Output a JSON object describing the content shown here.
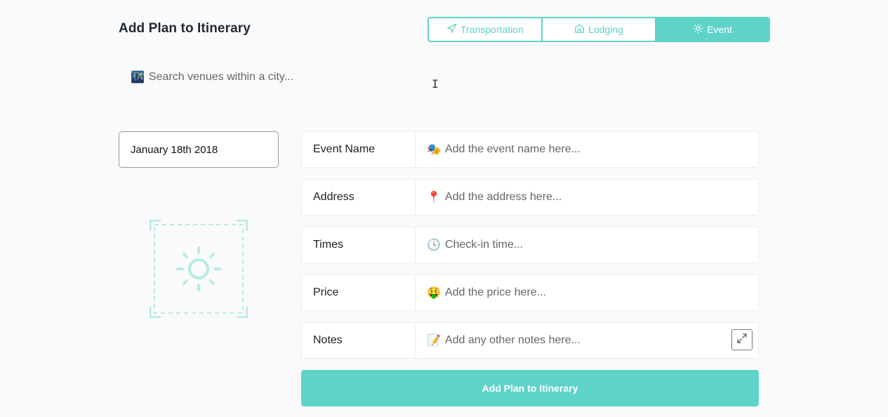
{
  "header": {
    "title": "Add Plan to Itinerary"
  },
  "plan_types": {
    "tabs": [
      {
        "label": "Transportation",
        "icon": "navigation-arrow-icon",
        "active": false
      },
      {
        "label": "Lodging",
        "icon": "house-icon",
        "active": false
      },
      {
        "label": "Event",
        "icon": "sun-icon",
        "active": true
      }
    ]
  },
  "search": {
    "icon": "🌃",
    "placeholder": "Search venues within a city..."
  },
  "date": {
    "value": "January 18th 2018"
  },
  "placeholder_icon": "sun-icon",
  "fields": {
    "event_name": {
      "label": "Event Name",
      "icon": "🎭",
      "placeholder": "Add the event name here..."
    },
    "address": {
      "label": "Address",
      "icon": "📍",
      "placeholder": "Add the address here..."
    },
    "times": {
      "label": "Times",
      "icon": "🕓",
      "placeholder": "Check-in time..."
    },
    "price": {
      "label": "Price",
      "icon": "🤑",
      "placeholder": "Add the price here..."
    },
    "notes": {
      "label": "Notes",
      "icon": "📝",
      "placeholder": "Add any other notes here..."
    }
  },
  "submit": {
    "label": "Add Plan to Itinerary"
  },
  "colors": {
    "accent": "#5ed3c8"
  }
}
